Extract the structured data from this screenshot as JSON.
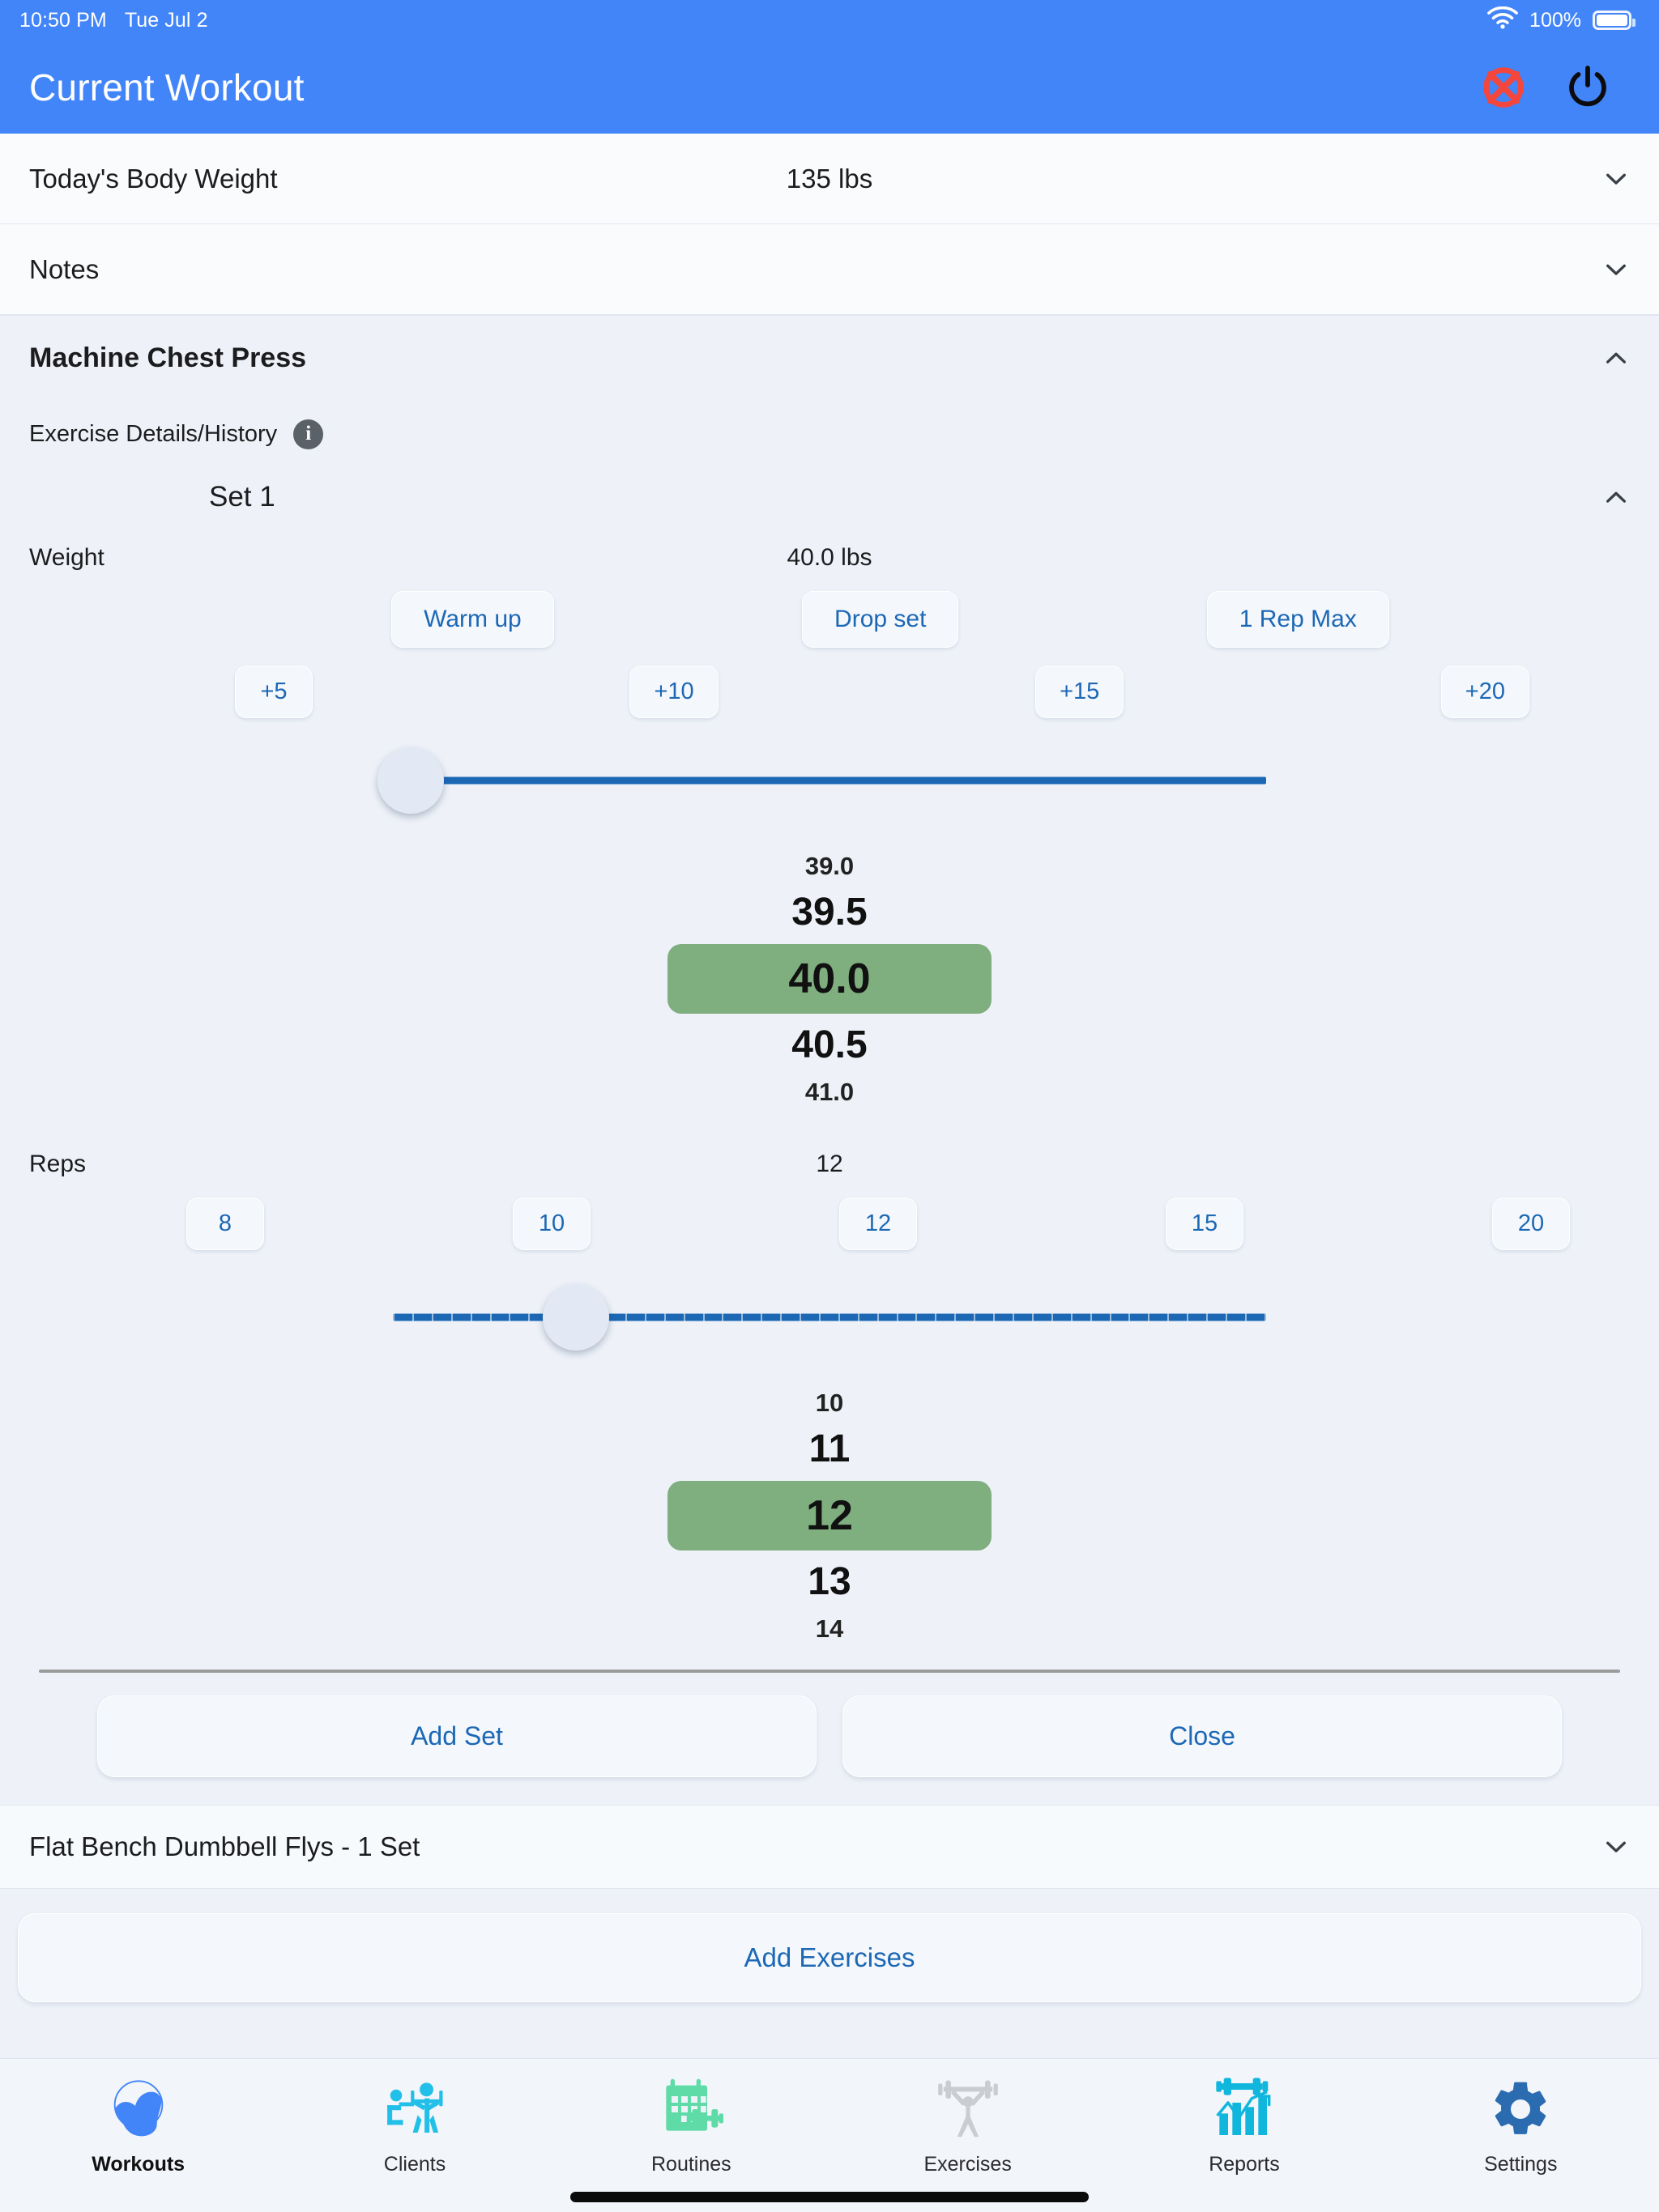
{
  "status_bar": {
    "time": "10:50 PM",
    "date": "Tue Jul 2",
    "battery_percent": "100%",
    "wifi_icon": "wifi-icon",
    "battery_icon": "battery-full-icon"
  },
  "navbar": {
    "title": "Current Workout",
    "cancel_icon": "cancel-circle-x-icon",
    "power_icon": "power-icon",
    "background_color": "#4285f8"
  },
  "body_weight_row": {
    "label": "Today's Body Weight",
    "value": "135 lbs",
    "chevron": "chevron-down-icon"
  },
  "notes_row": {
    "label": "Notes",
    "value": "",
    "chevron": "chevron-down-icon"
  },
  "exercise": {
    "title": "Machine Chest Press",
    "chevron": "chevron-up-icon",
    "details_label": "Exercise Details/History",
    "info_icon": "info-icon",
    "info_glyph": "i",
    "set_title": "Set 1",
    "set_chevron": "chevron-up-icon",
    "weight": {
      "label": "Weight",
      "value": "40.0 lbs",
      "mode_buttons": [
        "Warm up",
        "Drop set",
        "1 Rep Max"
      ],
      "increment_buttons": [
        "+5",
        "+10",
        "+15",
        "+20"
      ],
      "slider": {
        "percent": 2,
        "min_label": "",
        "max_label": ""
      },
      "picker": [
        {
          "text": "39.0",
          "size": "far",
          "selected": false
        },
        {
          "text": "39.5",
          "size": "near",
          "selected": false
        },
        {
          "text": "40.0",
          "size": "sel",
          "selected": true
        },
        {
          "text": "40.5",
          "size": "near",
          "selected": false
        },
        {
          "text": "41.0",
          "size": "far",
          "selected": false
        }
      ]
    },
    "reps": {
      "label": "Reps",
      "value": "12",
      "quick_buttons": [
        "8",
        "10",
        "12",
        "15",
        "20"
      ],
      "slider": {
        "percent": 21
      },
      "picker": [
        {
          "text": "10",
          "size": "far",
          "selected": false
        },
        {
          "text": "11",
          "size": "near",
          "selected": false
        },
        {
          "text": "12",
          "size": "sel",
          "selected": true
        },
        {
          "text": "13",
          "size": "near",
          "selected": false
        },
        {
          "text": "14",
          "size": "far",
          "selected": false
        }
      ]
    },
    "add_set_label": "Add Set",
    "close_label": "Close"
  },
  "collapsed_exercise": {
    "title": "Flat Bench Dumbbell Flys - 1 Set",
    "chevron": "chevron-down-icon"
  },
  "add_exercises_label": "Add Exercises",
  "tabs": [
    {
      "label": "Workouts",
      "icon": "muscle-flex-icon",
      "active": true
    },
    {
      "label": "Clients",
      "icon": "people-lifting-icon",
      "active": false
    },
    {
      "label": "Routines",
      "icon": "calendar-dumbbell-icon",
      "active": false
    },
    {
      "label": "Exercises",
      "icon": "barbell-lifter-icon",
      "active": false
    },
    {
      "label": "Reports",
      "icon": "bar-chart-dumbbell-icon",
      "active": false
    },
    {
      "label": "Settings",
      "icon": "gear-icon",
      "active": false
    }
  ],
  "colors": {
    "accent_blue": "#4285f8",
    "link_blue": "#1c68b5",
    "selection_green": "#7fae7f",
    "page_bg": "#eef2f8",
    "tab_cyan": "#22c0e8",
    "tab_green": "#5fdba8",
    "tab_gray": "#c9cdd2",
    "tab_settings_blue": "#2b6cb0"
  }
}
